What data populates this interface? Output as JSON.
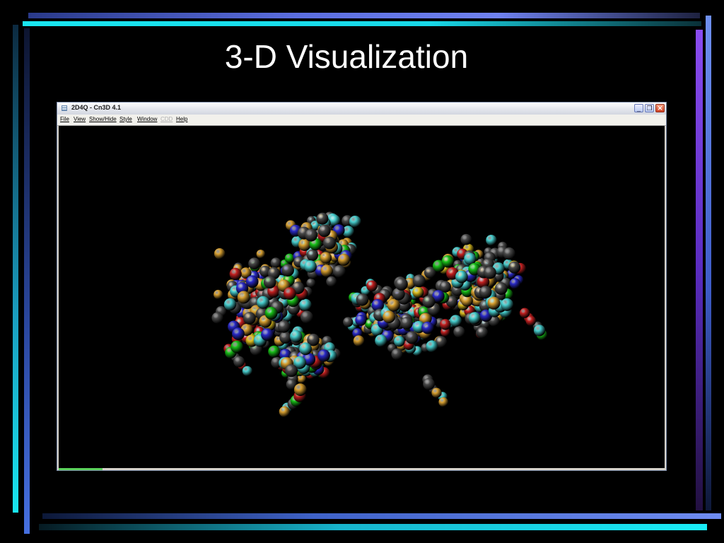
{
  "slide": {
    "title": "3-D Visualization"
  },
  "window": {
    "title": "2D4Q - Cn3D 4.1",
    "controls": {
      "minimize": "_",
      "restore": "❐",
      "close": "✕"
    }
  },
  "menu": {
    "items": [
      "File",
      "View",
      "Show/Hide",
      "Style",
      "Window",
      "CDD",
      "Help"
    ]
  },
  "colors": {
    "carbon": "#4a4a4a",
    "oxygen": "#c42020",
    "nitrogen": "#2a2ac8",
    "sulfur": "#e0c020",
    "cyan_residue": "#48d0d0",
    "gold_residue": "#d8a030",
    "green_residue": "#18c018"
  }
}
